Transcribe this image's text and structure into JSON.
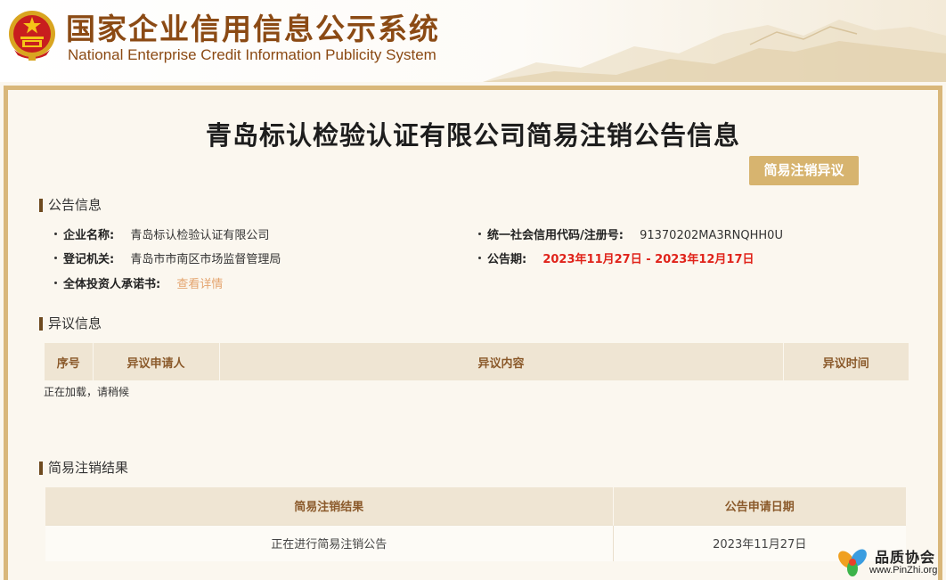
{
  "header": {
    "title_cn": "国家企业信用信息公示系统",
    "title_en": "National Enterprise Credit Information Publicity System",
    "emblem_icon": "national-emblem-icon"
  },
  "page": {
    "title": "青岛标认检验认证有限公司简易注销公告信息",
    "objection_button": "简易注销异议"
  },
  "announcement": {
    "section_title": "公告信息",
    "company_name_label": "企业名称:",
    "company_name": "青岛标认检验认证有限公司",
    "credit_code_label": "统一社会信用代码/注册号:",
    "credit_code": "91370202MA3RNQHH0U",
    "registry_label": "登记机关:",
    "registry": "青岛市市南区市场监督管理局",
    "period_label": "公告期:",
    "period": "2023年11月27日 - 2023年12月17日",
    "commitment_label": "全体投资人承诺书:",
    "commitment_link": "查看详情"
  },
  "objection": {
    "section_title": "异议信息",
    "columns": [
      "序号",
      "异议申请人",
      "异议内容",
      "异议时间"
    ],
    "loading": "正在加载，请稍候"
  },
  "result": {
    "section_title": "简易注销结果",
    "columns": [
      "简易注销结果",
      "公告申请日期"
    ],
    "rows": [
      [
        "正在进行简易注销公告",
        "2023年11月27日"
      ]
    ]
  },
  "watermark": {
    "name": "品质协会",
    "url": "www.PinZhi.org"
  },
  "colors": {
    "brand_brown": "#8b4a14",
    "gold": "#d7b46f",
    "highlight_red": "#e0231a",
    "link_orange": "#e4a46e"
  }
}
